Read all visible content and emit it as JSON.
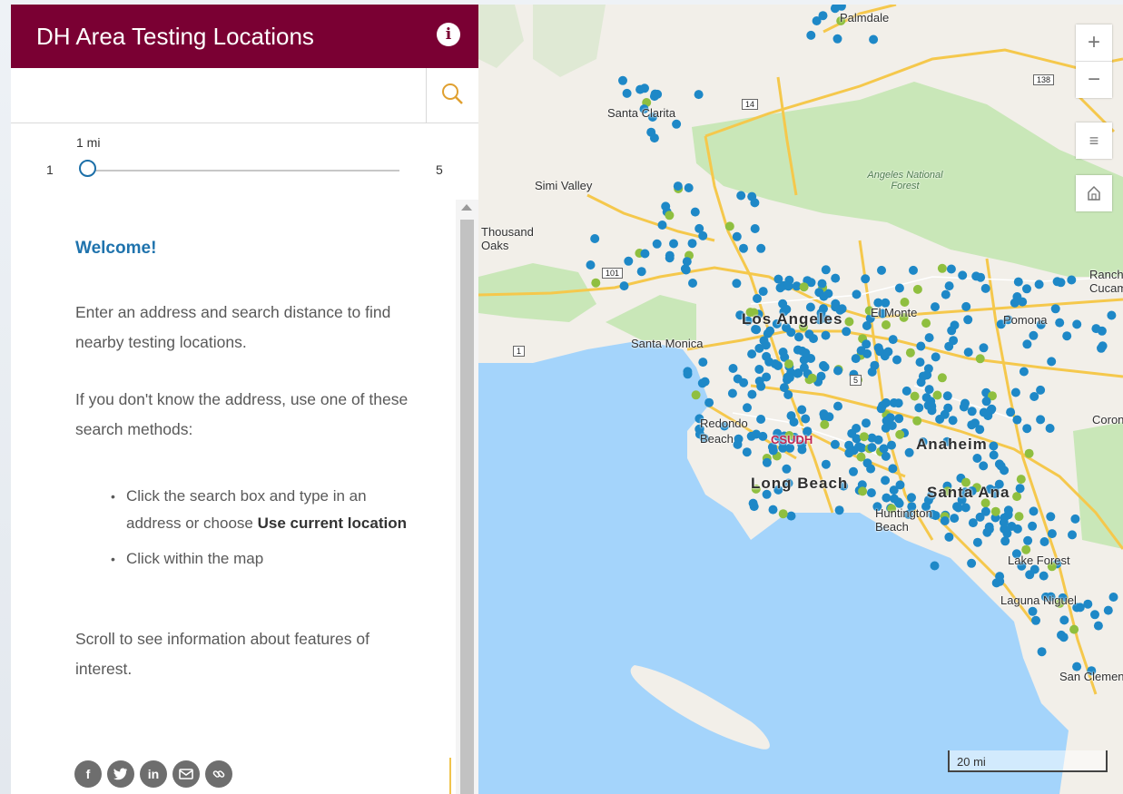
{
  "header": {
    "title": "DH Area Testing Locations",
    "info_icon": "info-icon"
  },
  "search": {
    "value": "",
    "placeholder": ""
  },
  "slider": {
    "current_label": "1 mi",
    "min_label": "1",
    "max_label": "5",
    "value": 1
  },
  "content": {
    "welcome": "Welcome!",
    "para1": "Enter an address and search distance to find nearby testing locations.",
    "para2": "If you don't know the address, use one of these search methods:",
    "bullet1_text": "Click the search box and type in an address or choose ",
    "bullet1_bold": "Use current location",
    "bullet2_text": "Click within the map",
    "para3": "Scroll to see information about features of interest."
  },
  "social": [
    "facebook-icon",
    "twitter-icon",
    "linkedin-icon",
    "email-icon",
    "link-icon"
  ],
  "map": {
    "labels": {
      "palmdale": "Palmdale",
      "santa_clarita": "Santa Clarita",
      "simi_valley": "Simi Valley",
      "thousand_oaks": "Thousand Oaks",
      "angeles_forest": "Angeles National Forest",
      "los_angeles": "Los Angeles",
      "el_monte": "El Monte",
      "pomona": "Pomona",
      "santa_monica": "Santa Monica",
      "redondo": "Redondo Beach",
      "csudh": "CSUDH",
      "anaheim": "Anaheim",
      "long_beach": "Long Beach",
      "santa_ana": "Santa Ana",
      "huntington": "Huntington Beach",
      "lake_forest": "Lake Forest",
      "laguna": "Laguna Niguel",
      "san_clemente": "San Clemente",
      "rancho": "Rancho Cucamonga",
      "corona": "Corona"
    },
    "shields": {
      "s14": "14",
      "s138": "138",
      "s101": "101",
      "s1": "1",
      "s5": "5"
    },
    "scale_label": "20 mi",
    "controls": [
      "zoom-in",
      "zoom-out",
      "layers",
      "home"
    ],
    "colors": {
      "site_blue": "#1e88c7",
      "site_green": "#8fbf3f",
      "land": "#f2efe9",
      "park": "#c9e7b8",
      "road": "#f5c84c"
    }
  }
}
